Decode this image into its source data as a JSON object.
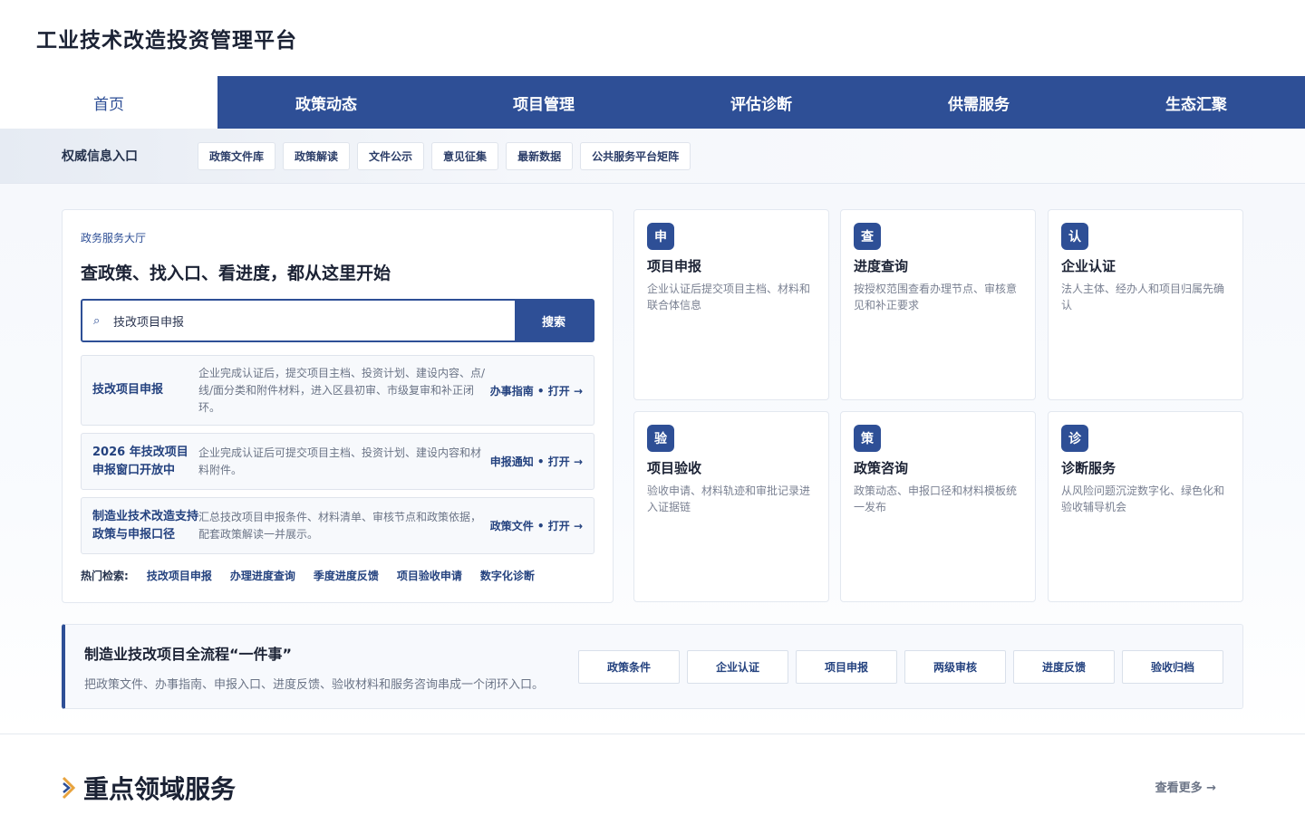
{
  "site": {
    "title": "工业技术改造投资管理平台"
  },
  "nav": [
    {
      "label": "首页"
    },
    {
      "label": "政策动态"
    },
    {
      "label": "项目管理"
    },
    {
      "label": "评估诊断"
    },
    {
      "label": "供需服务"
    },
    {
      "label": "生态汇聚"
    }
  ],
  "quick": {
    "label": "权威信息入口",
    "links": [
      "政策文件库",
      "政策解读",
      "文件公示",
      "意见征集",
      "最新数据",
      "公共服务平台矩阵"
    ]
  },
  "hall": {
    "tag": "政务服务大厅",
    "title": "查政策、找入口、看进度，都从这里开始",
    "search": {
      "value": "技改项目申报",
      "button": "搜索",
      "icon": "search-icon"
    },
    "services": [
      {
        "name": "技改项目申报",
        "desc": "企业完成认证后，提交项目主档、投资计划、建设内容、点/线/面分类和附件材料，进入区县初审、市级复审和补正闭环。",
        "link": "办事指南 • 打开 →"
      },
      {
        "name": "2026 年技改项目申报窗口开放中",
        "desc": "企业完成认证后可提交项目主档、投资计划、建设内容和材料附件。",
        "link": "申报通知 • 打开 →"
      },
      {
        "name": "制造业技术改造支持政策与申报口径",
        "desc": "汇总技改项目申报条件、材料清单、审核节点和政策依据，配套政策解读一并展示。",
        "link": "政策文件 • 打开 →"
      }
    ],
    "hot": {
      "label": "热门检索:",
      "items": [
        "技改项目申报",
        "办理进度查询",
        "季度进度反馈",
        "项目验收申请",
        "数字化诊断"
      ]
    }
  },
  "cards": [
    {
      "badge": "申",
      "title": "项目申报",
      "desc": "企业认证后提交项目主档、材料和联合体信息"
    },
    {
      "badge": "查",
      "title": "进度查询",
      "desc": "按授权范围查看办理节点、审核意见和补正要求"
    },
    {
      "badge": "认",
      "title": "企业认证",
      "desc": "法人主体、经办人和项目归属先确认"
    },
    {
      "badge": "验",
      "title": "项目验收",
      "desc": "验收申请、材料轨迹和审批记录进入证据链"
    },
    {
      "badge": "策",
      "title": "政策咨询",
      "desc": "政策动态、申报口径和材料模板统一发布"
    },
    {
      "badge": "诊",
      "title": "诊断服务",
      "desc": "从风险问题沉淀数字化、绿色化和验收辅导机会"
    }
  ],
  "flow": {
    "title": "制造业技改项目全流程“一件事”",
    "desc": "把政策文件、办事指南、申报入口、进度反馈、验收材料和服务咨询串成一个闭环入口。",
    "steps": [
      "政策条件",
      "企业认证",
      "项目申报",
      "两级审核",
      "进度反馈",
      "验收归档"
    ]
  },
  "section": {
    "title": "重点领域服务",
    "more": "查看更多 →"
  },
  "colors": {
    "primary": "#2e4f96",
    "accent": "#e8a33d"
  }
}
